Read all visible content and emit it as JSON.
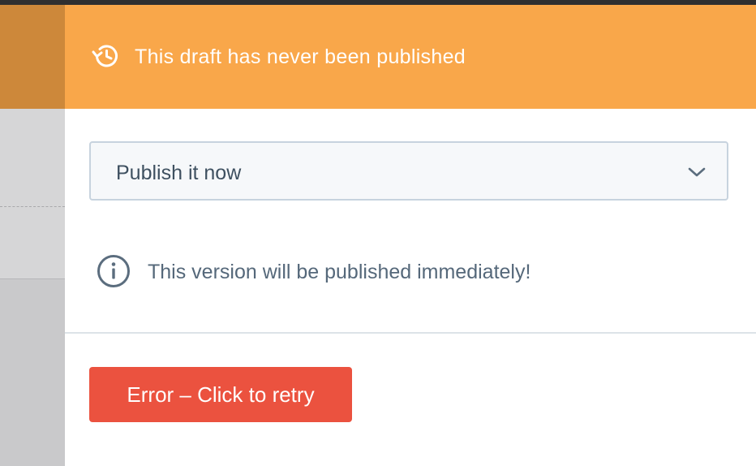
{
  "banner": {
    "icon": "history-clock-icon",
    "text": "This draft has never been published"
  },
  "publish_select": {
    "value": "Publish it now",
    "icon": "chevron-down-icon"
  },
  "info": {
    "icon": "info-circle-icon",
    "text": "This version will be published immediately!"
  },
  "actions": {
    "retry_label": "Error – Click to retry"
  },
  "colors": {
    "banner": "#f9a74a",
    "error_button": "#eb523f",
    "select_border": "#c7d3de",
    "text_muted": "#55687a"
  }
}
